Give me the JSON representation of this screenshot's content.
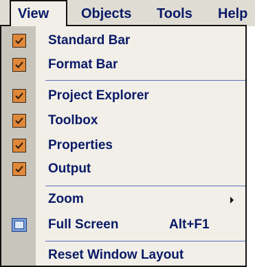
{
  "menubar": {
    "items": [
      {
        "label": "View",
        "active": true
      },
      {
        "label": "Objects",
        "active": false
      },
      {
        "label": "Tools",
        "active": false
      },
      {
        "label": "Help",
        "active": false
      }
    ]
  },
  "dropdown": {
    "items": [
      {
        "label": "Standard Bar",
        "checked": true,
        "icon": "checkmark-icon"
      },
      {
        "label": "Format Bar",
        "checked": true,
        "icon": "checkmark-icon"
      },
      {
        "label": "Project Explorer",
        "checked": true,
        "icon": "checkmark-icon"
      },
      {
        "label": "Toolbox",
        "checked": true,
        "icon": "checkmark-icon"
      },
      {
        "label": "Properties",
        "checked": true,
        "icon": "checkmark-icon"
      },
      {
        "label": "Output",
        "checked": true,
        "icon": "checkmark-icon"
      },
      {
        "label": "Zoom",
        "submenu": true,
        "icon": "submenu-arrow-icon"
      },
      {
        "label": "Full Screen",
        "shortcut": "Alt+F1",
        "icon": "fullscreen-icon"
      },
      {
        "label": "Reset Window Layout"
      }
    ]
  },
  "colors": {
    "menu_text": "#0a1a66",
    "checkbox_fill": "#e0883a",
    "gutter": "#c8c5bd",
    "menu_background": "#f1efe8",
    "separator": "#5b73b8"
  }
}
